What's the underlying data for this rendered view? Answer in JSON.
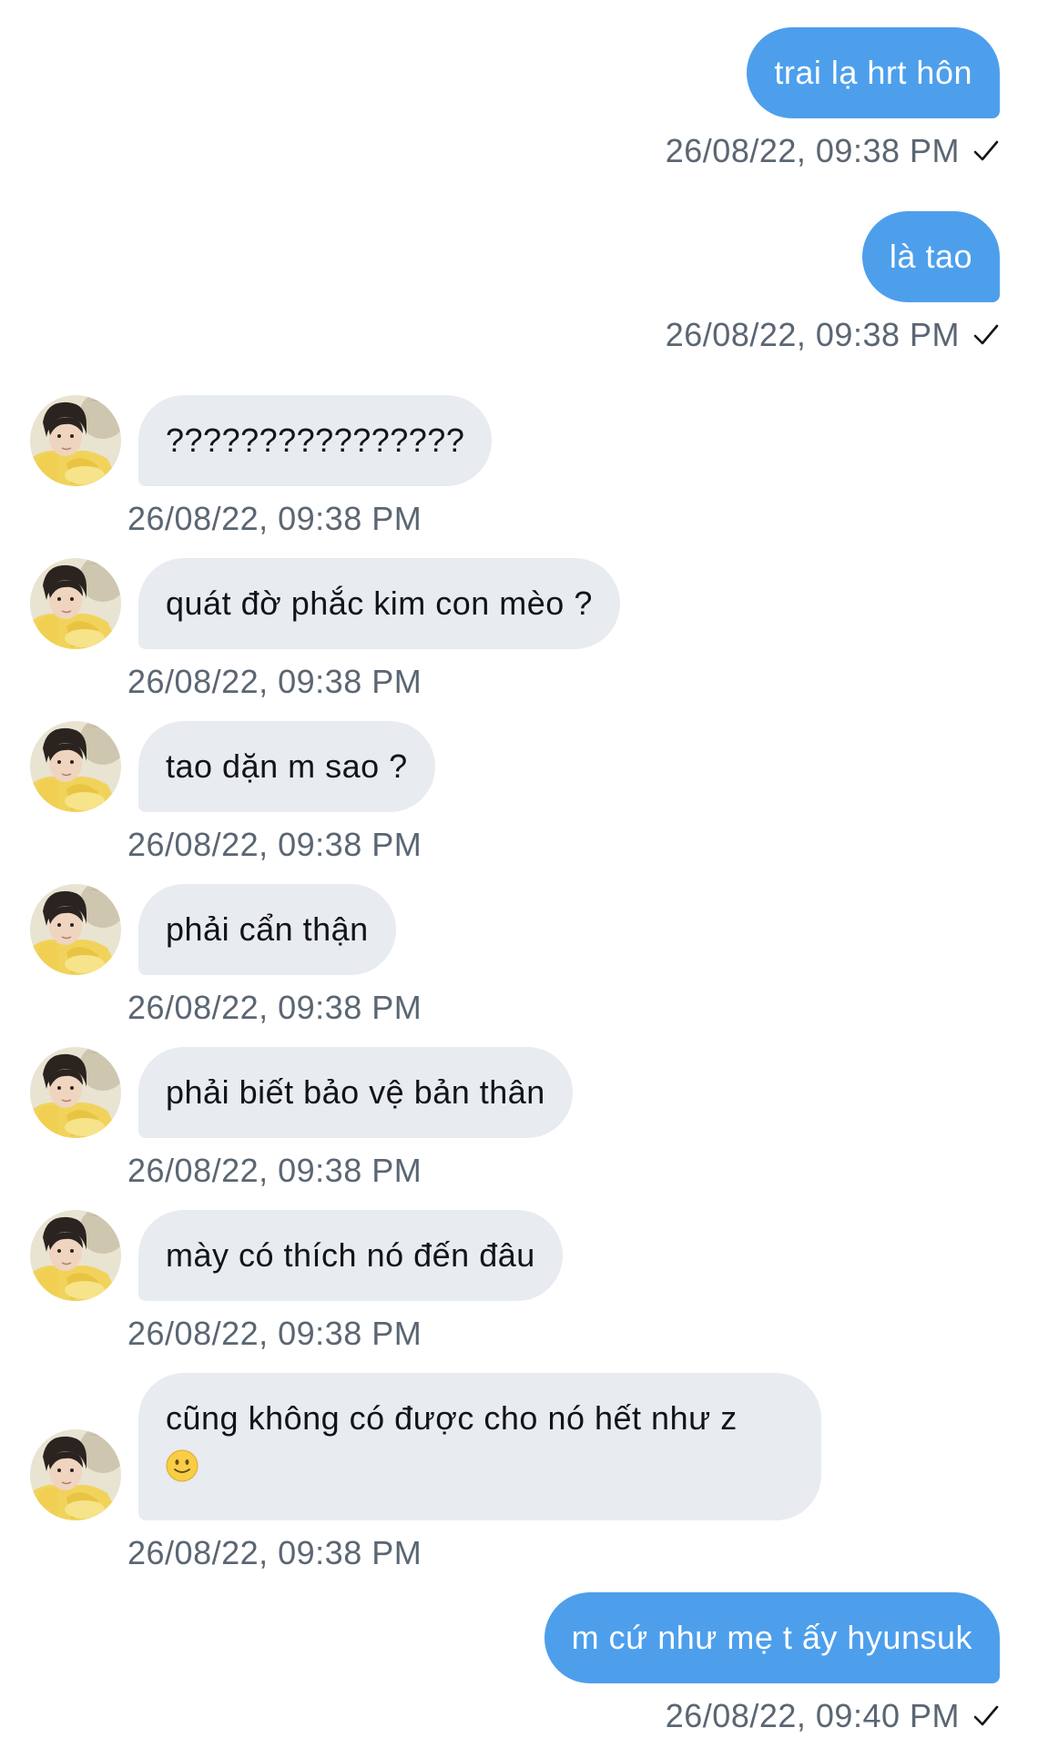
{
  "messages": [
    {
      "text": "trai lạ hrt hôn",
      "time": "26/08/22, 09:38 PM"
    },
    {
      "text": "là tao",
      "time": "26/08/22, 09:38 PM"
    },
    {
      "text": "????????????????",
      "time": "26/08/22, 09:38 PM"
    },
    {
      "text": "quát đờ phắc kim con mèo ?",
      "time": "26/08/22, 09:38 PM"
    },
    {
      "text": "tao dặn m sao ?",
      "time": "26/08/22, 09:38 PM"
    },
    {
      "text": "phải cẩn thận",
      "time": "26/08/22, 09:38 PM"
    },
    {
      "text": "phải biết bảo vệ bản thân",
      "time": "26/08/22, 09:38 PM"
    },
    {
      "text": "mày có thích nó đến đâu",
      "time": "26/08/22, 09:38 PM"
    },
    {
      "text": "cũng không có được cho nó hết như z",
      "emoji": "slightly-smiling-face",
      "time": "26/08/22, 09:38 PM"
    },
    {
      "text": "m cứ như mẹ t ấy hyunsuk",
      "time": "26/08/22, 09:40 PM"
    }
  ],
  "colors": {
    "outgoing_bubble": "#4d9fec",
    "incoming_bubble": "#e8ebef",
    "timestamp": "#5b6673"
  },
  "icons": {
    "sent_status": "checkmark-icon",
    "contact_avatar": "avatar"
  }
}
